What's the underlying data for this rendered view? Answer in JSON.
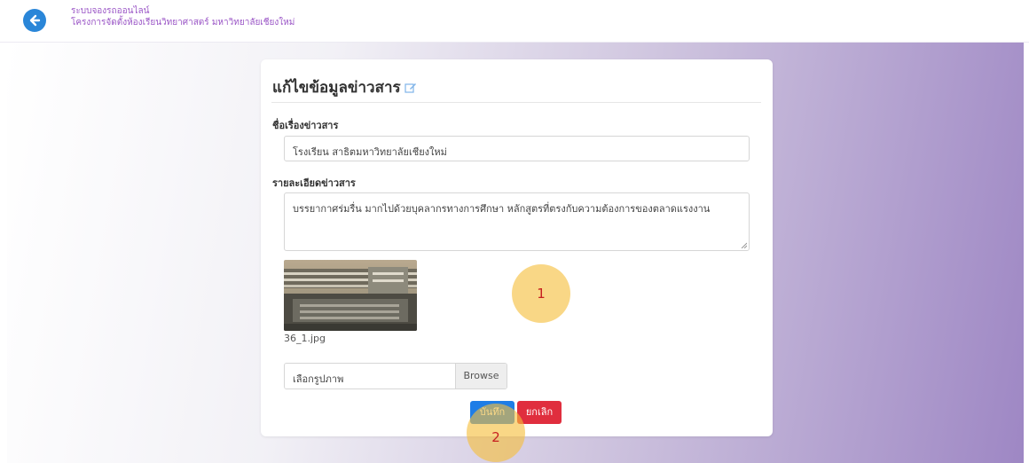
{
  "header": {
    "back_icon": "arrow-left-circle-icon",
    "brand_line1": "ระบบจองรถออนไลน์",
    "brand_line2": "โครงการจัดตั้งห้องเรียนวิทยาศาสตร์ มหาวิทยาลัยเชียงใหม่",
    "brand_color": "#9a55c6"
  },
  "card": {
    "title": "แก้ไขข้อมูลข่าวสาร",
    "title_icon": "edit-icon",
    "news_title_label": "ชื่อเรื่องข่าวสาร",
    "news_title_value": "โรงเรียน สาธิตมหาวิทยาลัยเชียงใหม่",
    "news_detail_label": "รายละเอียดข่าวสาร",
    "news_detail_value": "บรรยากาศร่มรื่น มากไปด้วยบุคลากรทางการศึกษา หลักสูตรที่ตรงกับความต้องการของตลาดแรงงาน",
    "image_filename": "36_1.jpg",
    "file_input_placeholder": "เลือกรูปภาพ",
    "browse_label": "Browse",
    "save_label": "บันทึก",
    "cancel_label": "ยกเลิก"
  },
  "annotations": {
    "marker_1": "1",
    "marker_2": "2"
  },
  "colors": {
    "save_button": "#1e7de6",
    "cancel_button": "#e02e3e",
    "marker_fill": "#f5be3c",
    "marker_text": "#c62020"
  }
}
